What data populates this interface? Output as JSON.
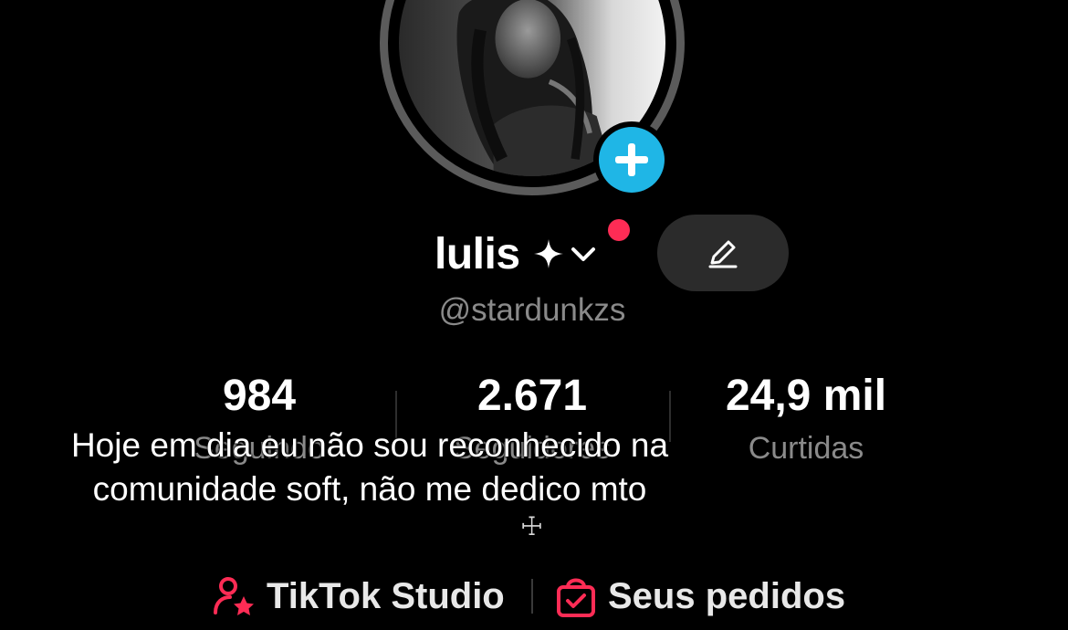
{
  "profile": {
    "display_name": "lulis",
    "username": "@stardunkzs",
    "name_sparkle_icon": "four-point-star-icon",
    "name_dropdown_icon": "chevron-down-icon",
    "edit_icon": "pencil-icon",
    "add_icon": "plus-icon"
  },
  "stats": [
    {
      "value": "984",
      "label": "Seguindo"
    },
    {
      "value": "2.671",
      "label": "Seguidores"
    },
    {
      "value": "24,9 mil",
      "label": "Curtidas"
    }
  ],
  "caption": {
    "text": "Hoje em dia eu não sou reconhecido na comunidade soft, não me dedico mto"
  },
  "bio_glyph": "☩",
  "links": {
    "studio": {
      "label": "TikTok Studio",
      "icon": "user-star-icon"
    },
    "orders": {
      "label": "Seus pedidos",
      "icon": "shopping-bag-check-icon"
    }
  },
  "colors": {
    "accent_red": "#fe2c55",
    "add_blue": "#1fb6e6",
    "muted_text": "#8a8a8a"
  }
}
